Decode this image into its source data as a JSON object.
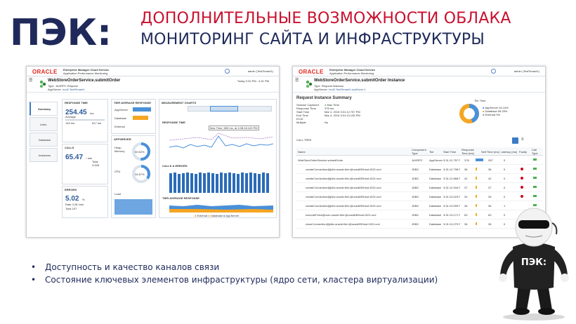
{
  "logo": {
    "text": "ПЭК:",
    "color": "#1f2a5a"
  },
  "title": {
    "line1": "ДОПОЛНИТЕЛЬНЫЕ ВОЗМОЖНОСТИ ОБЛАКА",
    "line2": "МОНИТОРИНГ САЙТА И ИНФРАСТРУКТУРЫ"
  },
  "bullets": [
    "Доступность и качество каналов связи",
    "Состояние ключевых элементов инфраструктуры (ядро сети, кластера виртуализации)"
  ],
  "left_screenshot": {
    "brand": "ORACLE",
    "app_title": "Enterprise Manager Cloud Service",
    "app_subtitle": "Application Performance Monitoring",
    "user": "admin (TestTenant1)",
    "service_title": "WebStoreOrderService.submitOrder",
    "meta": [
      {
        "label": "Type",
        "value": "JAXRPC Request"
      },
      {
        "label": "AppServer",
        "value": "tool2.TestTenant1"
      },
      {
        "label": "Deployment",
        "value": "WebStore2.ear"
      }
    ],
    "time_range": "Today 3:31 PM - 4:31 PM",
    "nav": [
      "Summary",
      "Links",
      "Database",
      "Instances"
    ],
    "response_time": {
      "title": "RESPONSE TIME",
      "value": "254.45",
      "unit": "ms",
      "avg_label": "Average",
      "min": "149 ms",
      "max": "817 ms"
    },
    "calls": {
      "title": "CALLS",
      "value": "65.47",
      "unit": "/ min",
      "total_label": "Total",
      "total": "3,928"
    },
    "errors": {
      "title": "ERRORS",
      "value": "5.02",
      "unit": "%",
      "rate_label": "Rate",
      "rate": "3.28 /min",
      "total_label": "Total",
      "total": "197"
    },
    "tier_avg": {
      "title": "TIER AVERAGE RESPONSE",
      "tiers": [
        "AppServer",
        "Database",
        "External"
      ]
    },
    "appserver": {
      "title": "APPSERVER",
      "metrics": [
        {
          "label": "Heap Memory",
          "value": "50.52%"
        },
        {
          "label": "CPU",
          "value": "34.87%"
        },
        {
          "label": "Load",
          "value": ""
        }
      ]
    },
    "measurement": {
      "title": "MEASUREMENT CHARTS",
      "time_labels": [
        "3:40 PM",
        "4:00 PM",
        "4:20 PM"
      ]
    },
    "chart_titles": [
      "RESPONSE TIME",
      "CALLS & ERRORS",
      "TIER AVERAGE RESPONSE"
    ],
    "legend_rt": [
      "Avg Response Time",
      "Max Time",
      "Normal",
      "Fault"
    ],
    "legend_ce": [
      "Errors",
      "Successful Calls"
    ],
    "legend_tier": [
      "External",
      "Database",
      "AppServer"
    ],
    "tooltip": "Max Time, 669 ms, at 4:08:18.419 PM"
  },
  "right_screenshot": {
    "brand": "ORACLE",
    "app_title": "Enterprise Manager Cloud Service",
    "app_subtitle": "Application Performance Monitoring",
    "user": "admin (TestTenant1)",
    "service_title": "WebStoreOrderService.submitOrder Instance",
    "meta": [
      {
        "label": "Type",
        "value": "Request Instance"
      },
      {
        "label": "AppServer",
        "value": "tool2.TestTenant1.tool2dom-1"
      },
      {
        "label": "Start Time",
        "value": "Mar 4, 2015 3:31:12.757 PM"
      }
    ],
    "summary_title": "Request Instance Summary",
    "summary_rows": [
      {
        "label": "Session Captured",
        "value": ""
      },
      {
        "label": "Response Time",
        "value": "378 ms"
      },
      {
        "label": "Start Time",
        "value": "Mar 4, 2015 3:31:12.757 PM"
      },
      {
        "label": "End Time",
        "value": "Mar 4, 2015 3:31:13.135 PM"
      },
      {
        "label": "ECID",
        "value": ""
      },
      {
        "label": "Multiple",
        "value": "No"
      }
    ],
    "max_time": "Max Time",
    "tier_time": {
      "title": "Tier Time",
      "items": [
        "AppServer 44.14%",
        "Database 55.25%",
        "External 0%"
      ]
    },
    "call_tree": "CALL TREE",
    "columns": [
      "Name",
      "Component Type",
      "Tier",
      "Start Time",
      "Response Time (ms)",
      "Self Time (ms)",
      "Latency (ms)",
      "Faulty",
      "Call Type"
    ],
    "rows": [
      {
        "name": "WebStoreOrderService.submitOrder",
        "type": "JAXRPC",
        "tier": "AppServer",
        "start": "3:31:12.757 PM",
        "resp": "378",
        "self": "287",
        "lat": "0"
      },
      {
        "name": "createConnection@jdbc:oracle:thin:@oceaDBHost:1521:orcl",
        "type": "JDBC",
        "tier": "Database",
        "start": "3:31:12.798 PM",
        "resp": "38",
        "self": "38",
        "lat": "0"
      },
      {
        "name": "createConnection@jdbc:oracle:thin:@oceaDBHost:1521:orcl",
        "type": "JDBC",
        "tier": "Database",
        "start": "3:31:12.868 PM",
        "resp": "42",
        "self": "42",
        "lat": "0"
      },
      {
        "name": "createConnection@jdbc:oracle:thin:@oceaDBHost:1521:orcl",
        "type": "JDBC",
        "tier": "Database",
        "start": "3:31:12.944 PM",
        "resp": "37",
        "self": "37",
        "lat": "0"
      },
      {
        "name": "createConnection@jdbc:oracle:thin:@oceaDBHost:1521:orcl",
        "type": "JDBC",
        "tier": "Database",
        "start": "3:31:13.023 PM",
        "resp": "39",
        "self": "39",
        "lat": "0"
      },
      {
        "name": "createConnection@jdbc:oracle:thin:@oceaDBHost:1521:orcl",
        "type": "JDBC",
        "tier": "Database",
        "start": "3:31:13.099 PM",
        "resp": "36",
        "self": "36",
        "lat": "1"
      },
      {
        "name": "executeFetch@com.oracle:thin:@oceaDBHost:1521:orcl",
        "type": "JDBC",
        "tier": "Database",
        "start": "3:31:13.171 PM",
        "resp": "63",
        "self": "63",
        "lat": "0"
      },
      {
        "name": "closeConnection@jdbc:oracle:thin:@oceaDBHost:1521:orcl",
        "type": "JDBC",
        "tier": "Database",
        "start": "3:31:13.279 PM",
        "resp": "36",
        "self": "36",
        "lat": "0"
      }
    ]
  },
  "mascot": {
    "shirt_text": "ПЭК:"
  },
  "colors": {
    "red": "#c8102e",
    "navy": "#1f2a5a",
    "oracle_red": "#e0261b",
    "blue": "#4a90d9",
    "orange": "#f5a623",
    "green": "#4caf50"
  }
}
